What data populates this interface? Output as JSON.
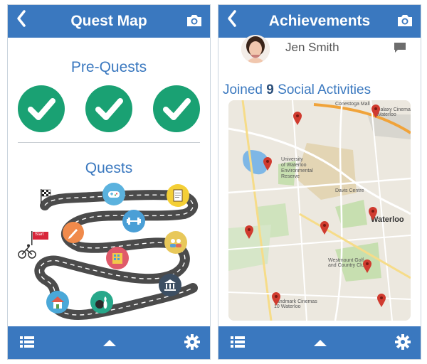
{
  "left_screen": {
    "header": {
      "title": "Quest Map",
      "back_icon": "back-chevron-icon",
      "camera_icon": "camera-icon"
    },
    "pre_quests": {
      "title": "Pre-Quests",
      "completed_count": 3
    },
    "quests": {
      "title": "Quests",
      "start_flag_label": "Start",
      "nodes": [
        {
          "icon": "gamepad-icon",
          "color": "#5bb2de"
        },
        {
          "icon": "notepad-icon",
          "color": "#f4cf36"
        },
        {
          "icon": "pencil-icon",
          "color": "#f08a4b"
        },
        {
          "icon": "dumbbell-icon",
          "color": "#4a9fd6"
        },
        {
          "icon": "people-icon",
          "color": "#e8c85a"
        },
        {
          "icon": "building-icon",
          "color": "#e05a6a"
        },
        {
          "icon": "bank-icon",
          "color": "#3d4f63"
        },
        {
          "icon": "house-icon",
          "color": "#4aa8d8"
        },
        {
          "icon": "bowling-icon",
          "color": "#27a88a"
        }
      ]
    },
    "footer": {
      "list_icon": "list-icon",
      "up_icon": "up-arrow-icon",
      "settings_icon": "gear-icon"
    }
  },
  "right_screen": {
    "header": {
      "title": "Achievements",
      "back_icon": "back-chevron-icon",
      "camera_icon": "camera-icon"
    },
    "user": {
      "name": "Jen Smith",
      "comment_icon": "comment-icon"
    },
    "activities": {
      "prefix": "Joined",
      "count": "9",
      "suffix": "Social Activities"
    },
    "map": {
      "labels": {
        "conestoga": "Conestoga Mall",
        "galaxy": "Galaxy Cinemas\nWaterloo",
        "uw": "University\nof Waterloo\nEnvironmental\nReserve",
        "davis": "Davis Centre",
        "waterloo": "Waterloo",
        "westmount": "Westmount Golf\nand Country Club",
        "landmark": "Landmark Cinemas\n10 Waterloo"
      },
      "pin_color": "#d03b2f",
      "pin_count": 9
    },
    "footer": {
      "list_icon": "list-icon",
      "up_icon": "up-arrow-icon",
      "settings_icon": "gear-icon"
    }
  }
}
